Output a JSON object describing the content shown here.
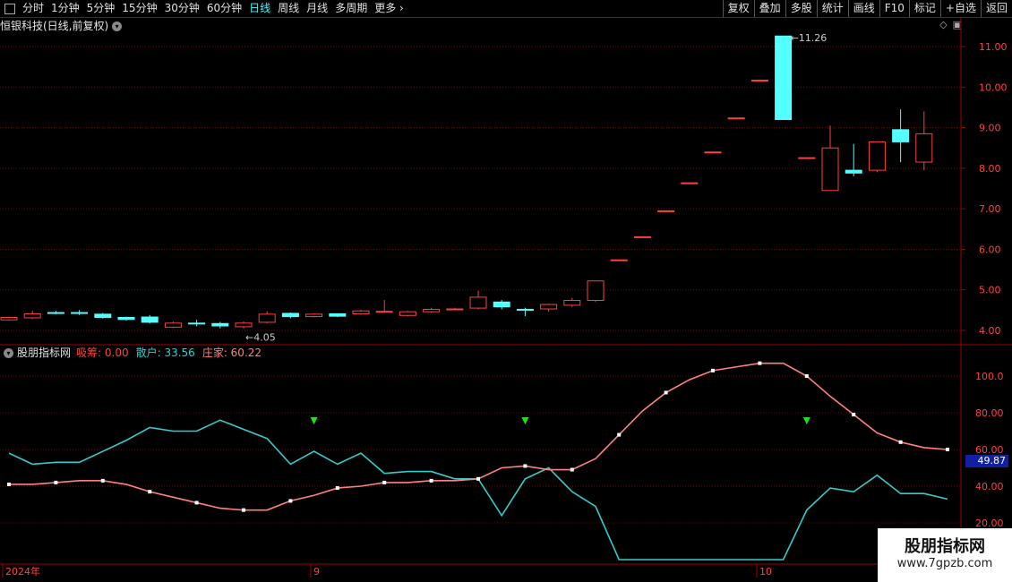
{
  "toolbar": {
    "periods": [
      "分时",
      "1分钟",
      "5分钟",
      "15分钟",
      "30分钟",
      "60分钟",
      "日线",
      "周线",
      "月线",
      "多周期",
      "更多"
    ],
    "active_period": "日线",
    "right_buttons": [
      "复权",
      "叠加",
      "多股",
      "统计",
      "画线",
      "F10",
      "标记",
      "+自选",
      "返回"
    ]
  },
  "stock_title": "恒银科技(日线,前复权)",
  "indicator": {
    "name": "股朋指标网",
    "items": [
      {
        "label": "吸筹: 0.00",
        "color": "#ff4040"
      },
      {
        "label": "散户: 33.56",
        "color": "#3cc"
      },
      {
        "label": "庄家: 60.22",
        "color": "#ff8080"
      }
    ],
    "cursor_value": "49.87"
  },
  "price_axis": [
    "11.00",
    "10.00",
    "9.00",
    "8.00",
    "7.00",
    "6.00",
    "5.00",
    "4.00"
  ],
  "indicator_axis": [
    "100.0",
    "80.00",
    "60.00",
    "40.00",
    "20.00"
  ],
  "annotations": {
    "high": "11.26",
    "low": "4.05"
  },
  "date_axis": [
    "2024年",
    "9",
    "10"
  ],
  "watermark": {
    "line1": "股朋指标网",
    "line2": "www.7gpzb.com"
  },
  "colors": {
    "up": "#ff4040",
    "down": "#54ffff",
    "grid": "#7a0000",
    "zhuangjia": "#ff8080",
    "sanhu": "#3cc",
    "signal": "#20e020"
  },
  "chart_data": [
    {
      "type": "candlestick",
      "title": "恒银科技(日线,前复权)",
      "y_axis_ticks": [
        4,
        5,
        6,
        7,
        8,
        9,
        10,
        11
      ],
      "ylim": [
        3.7,
        11.5
      ],
      "candles": [
        {
          "o": 4.26,
          "c": 4.32,
          "h": 4.34,
          "l": 4.24
        },
        {
          "o": 4.31,
          "c": 4.41,
          "h": 4.48,
          "l": 4.28
        },
        {
          "o": 4.44,
          "c": 4.43,
          "h": 4.48,
          "l": 4.4
        },
        {
          "o": 4.44,
          "c": 4.43,
          "h": 4.5,
          "l": 4.38
        },
        {
          "o": 4.4,
          "c": 4.32,
          "h": 4.43,
          "l": 4.29
        },
        {
          "o": 4.32,
          "c": 4.27,
          "h": 4.34,
          "l": 4.24
        },
        {
          "o": 4.33,
          "c": 4.2,
          "h": 4.38,
          "l": 4.17
        },
        {
          "o": 4.08,
          "c": 4.18,
          "h": 4.22,
          "l": 4.06
        },
        {
          "o": 4.18,
          "c": 4.17,
          "h": 4.26,
          "l": 4.1
        },
        {
          "o": 4.17,
          "c": 4.11,
          "h": 4.21,
          "l": 4.05
        },
        {
          "o": 4.09,
          "c": 4.18,
          "h": 4.22,
          "l": 4.05
        },
        {
          "o": 4.2,
          "c": 4.4,
          "h": 4.47,
          "l": 4.18
        },
        {
          "o": 4.42,
          "c": 4.34,
          "h": 4.44,
          "l": 4.3
        },
        {
          "o": 4.34,
          "c": 4.4,
          "h": 4.42,
          "l": 4.32
        },
        {
          "o": 4.41,
          "c": 4.35,
          "h": 4.42,
          "l": 4.33
        },
        {
          "o": 4.41,
          "c": 4.48,
          "h": 4.51,
          "l": 4.39
        },
        {
          "o": 4.47,
          "c": 4.47,
          "h": 4.75,
          "l": 4.45
        },
        {
          "o": 4.37,
          "c": 4.46,
          "h": 4.48,
          "l": 4.35
        },
        {
          "o": 4.46,
          "c": 4.52,
          "h": 4.56,
          "l": 4.44
        },
        {
          "o": 4.52,
          "c": 4.53,
          "h": 4.56,
          "l": 4.5
        },
        {
          "o": 4.55,
          "c": 4.82,
          "h": 4.98,
          "l": 4.52
        },
        {
          "o": 4.7,
          "c": 4.58,
          "h": 4.75,
          "l": 4.52
        },
        {
          "o": 4.52,
          "c": 4.51,
          "h": 4.56,
          "l": 4.35
        },
        {
          "o": 4.53,
          "c": 4.64,
          "h": 4.66,
          "l": 4.46
        },
        {
          "o": 4.62,
          "c": 4.74,
          "h": 4.8,
          "l": 4.58
        },
        {
          "o": 4.74,
          "c": 5.22,
          "h": 5.22,
          "l": 4.7
        },
        {
          "o": 5.74,
          "c": 5.74,
          "h": 5.74,
          "l": 5.74
        },
        {
          "o": 6.31,
          "c": 6.31,
          "h": 6.31,
          "l": 6.31
        },
        {
          "o": 6.95,
          "c": 6.95,
          "h": 6.95,
          "l": 6.95
        },
        {
          "o": 7.64,
          "c": 7.64,
          "h": 7.64,
          "l": 7.64
        },
        {
          "o": 8.4,
          "c": 8.4,
          "h": 8.4,
          "l": 8.4
        },
        {
          "o": 9.24,
          "c": 9.24,
          "h": 9.24,
          "l": 9.24
        },
        {
          "o": 10.17,
          "c": 10.17,
          "h": 10.17,
          "l": 10.17
        },
        {
          "o": 11.26,
          "c": 9.2,
          "h": 11.26,
          "l": 9.2
        },
        {
          "o": 8.26,
          "c": 8.26,
          "h": 8.26,
          "l": 8.26
        },
        {
          "o": 7.45,
          "c": 8.5,
          "h": 9.05,
          "l": 7.45
        },
        {
          "o": 7.95,
          "c": 7.88,
          "h": 8.6,
          "l": 7.8
        },
        {
          "o": 7.95,
          "c": 8.65,
          "h": 8.65,
          "l": 7.9
        },
        {
          "o": 8.95,
          "c": 8.65,
          "h": 9.45,
          "l": 8.15
        },
        {
          "o": 8.15,
          "c": 8.85,
          "h": 9.4,
          "l": 7.95
        }
      ]
    },
    {
      "type": "line",
      "title": "股朋指标网",
      "y_axis_ticks": [
        20,
        40,
        60,
        80,
        100
      ],
      "ylim": [
        12,
        117
      ],
      "series": [
        {
          "name": "散户",
          "values": [
            58,
            52,
            53,
            53,
            59,
            65,
            72,
            70,
            70,
            76,
            71,
            66,
            52,
            59,
            52,
            58,
            47,
            48,
            48,
            44,
            44,
            24,
            44,
            50,
            37,
            29,
            0,
            0,
            0,
            0,
            0,
            0,
            0,
            0,
            27,
            39,
            37,
            46,
            36,
            36,
            33
          ]
        },
        {
          "name": "庄家",
          "values": [
            41,
            41,
            42,
            43,
            43,
            41,
            37,
            34,
            31,
            28,
            27,
            27,
            32,
            35,
            39,
            40,
            42,
            42,
            43,
            43,
            44,
            50,
            51,
            49,
            49,
            55,
            68,
            81,
            91,
            98,
            103,
            105,
            107,
            107,
            100,
            89,
            79,
            69,
            64,
            61,
            60
          ]
        }
      ],
      "signals_index": [
        13,
        22,
        34
      ]
    }
  ]
}
